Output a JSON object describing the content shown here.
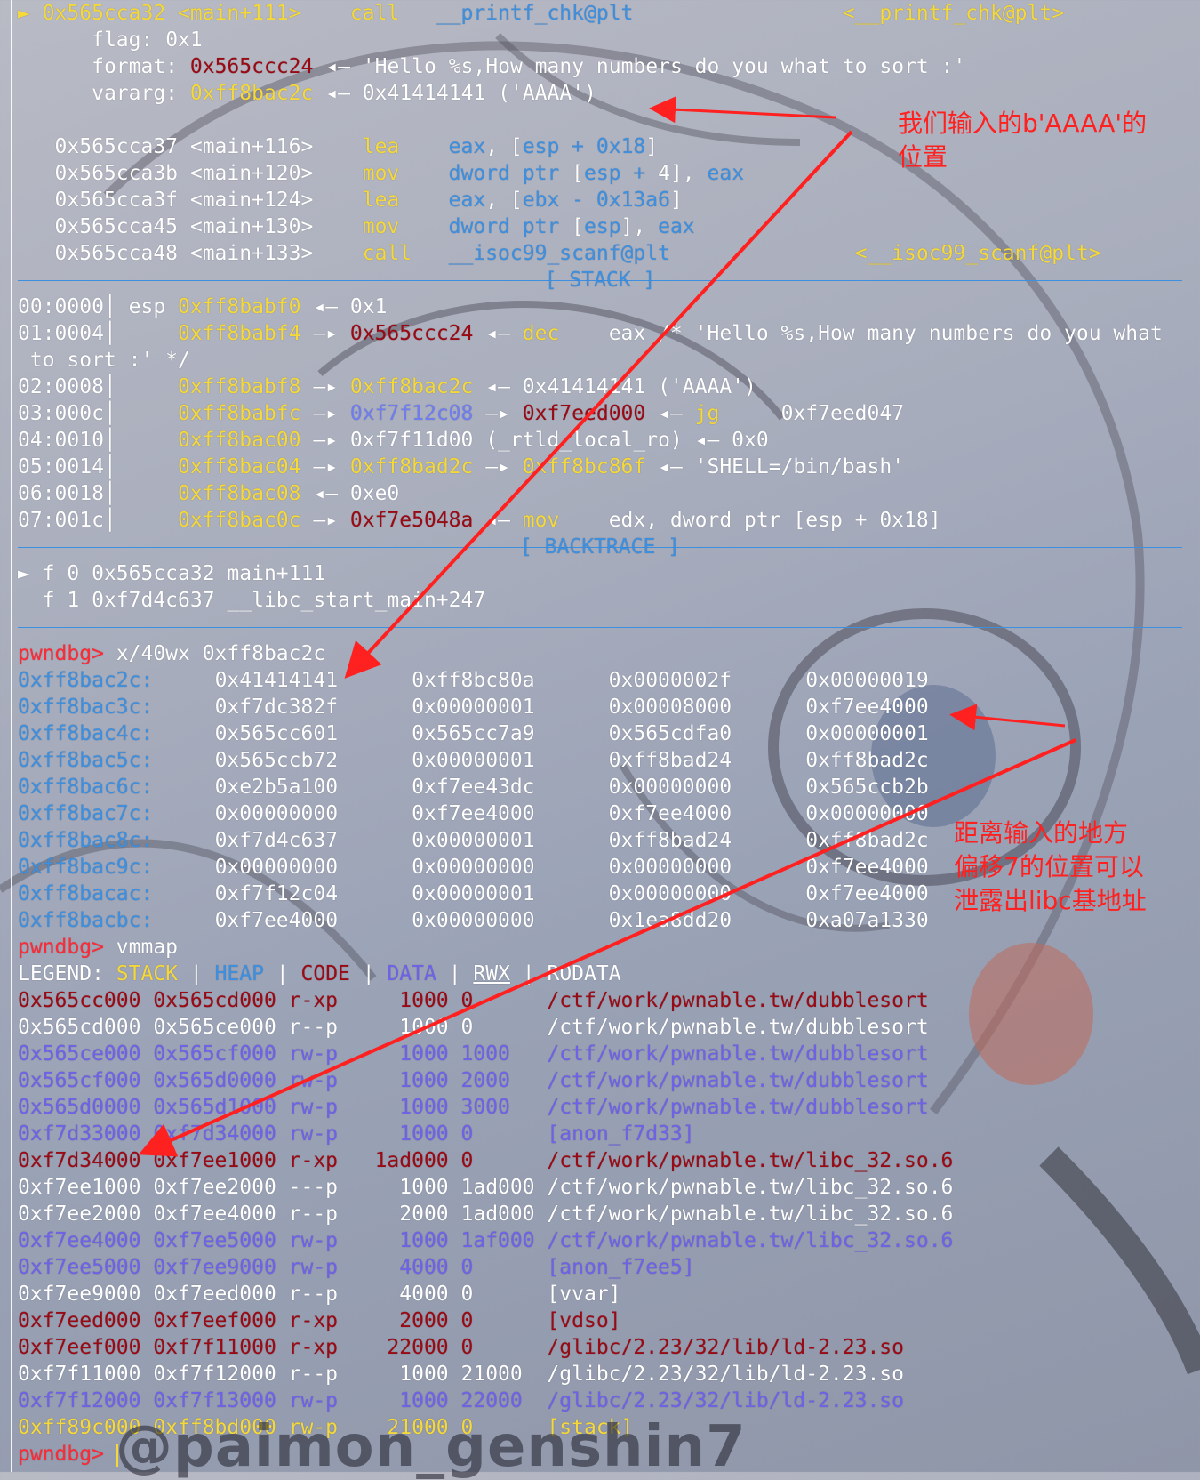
{
  "terminal": {
    "disasm": [
      {
        "marker": "►",
        "addr": "0x565cca32",
        "sym": "<main+111>",
        "mn": "call",
        "op": "__printf_chk@plt",
        "target": "<__printf_chk@plt>"
      },
      {
        "indent": "      ",
        "label": "flag:",
        "val": "0x1"
      },
      {
        "indent": "      ",
        "label": "format:",
        "val": "0x565ccc24",
        "arrow": "◂—",
        "rest": "'Hello %s,How many numbers do you what to sort :'"
      },
      {
        "indent": "      ",
        "label": "vararg:",
        "val": "0xff8bac2c",
        "arrow": "◂—",
        "rest": "0x41414141 ('AAAA')"
      },
      {
        "addr": "0x565cca37",
        "sym": "<main+116>",
        "mn": "lea",
        "op": "eax, [esp + 0x18]"
      },
      {
        "addr": "0x565cca3b",
        "sym": "<main+120>",
        "mn": "mov",
        "op": "dword ptr [esp + 4], eax"
      },
      {
        "addr": "0x565cca3f",
        "sym": "<main+124>",
        "mn": "lea",
        "op": "eax, [ebx - 0x13a6]"
      },
      {
        "addr": "0x565cca45",
        "sym": "<main+130>",
        "mn": "mov",
        "op": "dword ptr [esp], eax"
      },
      {
        "addr": "0x565cca48",
        "sym": "<main+133>",
        "mn": "call",
        "op": "__isoc99_scanf@plt",
        "target": "<__isoc99_scanf@plt>"
      }
    ],
    "stack_header": "[ STACK ]",
    "stack": [
      "00:0000│ esp 0xff8babf0 ◂— 0x1",
      "01:0004│     0xff8babf4 —▸ 0x565ccc24 ◂— dec    eax /* 'Hello %s,How many numbers do you what",
      " to sort :' */",
      "02:0008│     0xff8babf8 —▸ 0xff8bac2c ◂— 0x41414141 ('AAAA')",
      "03:000c│     0xff8babfc —▸ 0xf7f12c08 —▸ 0xf7eed000 ◂— jg     0xf7eed047",
      "04:0010│     0xff8bac00 —▸ 0xf7f11d00 (_rtld_local_ro) ◂— 0x0",
      "05:0014│     0xff8bac04 —▸ 0xff8bad2c —▸ 0xff8bc86f ◂— 'SHELL=/bin/bash'",
      "06:0018│     0xff8bac08 ◂— 0xe0",
      "07:001c│     0xff8bac0c —▸ 0xf7e5048a ◂— mov    edx, dword ptr [esp + 0x18]"
    ],
    "backtrace_header": "[ BACKTRACE ]",
    "backtrace": [
      "► f 0 0x565cca32 main+111",
      "  f 1 0xf7d4c637 __libc_start_main+247"
    ],
    "prompt": "pwndbg>",
    "cmd1": " x/40wx 0xff8bac2c",
    "mem": [
      {
        "a": "0xff8bac2c:",
        "v": [
          "0x41414141",
          "0xff8bc80a",
          "0x0000002f",
          "0x00000019"
        ]
      },
      {
        "a": "0xff8bac3c:",
        "v": [
          "0xf7dc382f",
          "0x00000001",
          "0x00008000",
          "0xf7ee4000"
        ]
      },
      {
        "a": "0xff8bac4c:",
        "v": [
          "0x565cc601",
          "0x565cc7a9",
          "0x565cdfa0",
          "0x00000001"
        ]
      },
      {
        "a": "0xff8bac5c:",
        "v": [
          "0x565ccb72",
          "0x00000001",
          "0xff8bad24",
          "0xff8bad2c"
        ]
      },
      {
        "a": "0xff8bac6c:",
        "v": [
          "0xe2b5a100",
          "0xf7ee43dc",
          "0x00000000",
          "0x565ccb2b"
        ]
      },
      {
        "a": "0xff8bac7c:",
        "v": [
          "0x00000000",
          "0xf7ee4000",
          "0xf7ee4000",
          "0x00000000"
        ]
      },
      {
        "a": "0xff8bac8c:",
        "v": [
          "0xf7d4c637",
          "0x00000001",
          "0xff8bad24",
          "0xff8bad2c"
        ]
      },
      {
        "a": "0xff8bac9c:",
        "v": [
          "0x00000000",
          "0x00000000",
          "0x00000000",
          "0xf7ee4000"
        ]
      },
      {
        "a": "0xff8bacac:",
        "v": [
          "0xf7f12c04",
          "0x00000001",
          "0x00000000",
          "0xf7ee4000"
        ]
      },
      {
        "a": "0xff8bacbc:",
        "v": [
          "0xf7ee4000",
          "0x00000000",
          "0x1ea8dd20",
          "0xa07a1330"
        ]
      }
    ],
    "cmd2": " vmmap",
    "legend": {
      "label": "LEGEND:",
      "stack": "STACK",
      "heap": "HEAP",
      "code": "CODE",
      "data": "DATA",
      "rwx": "RWX",
      "rodata": "RODATA"
    },
    "vmmap": [
      {
        "c": "r",
        "t": "0x565cc000 0x565cd000 r-xp     1000 0      /ctf/work/pwnable.tw/dubblesort"
      },
      {
        "c": "wt",
        "t": "0x565cd000 0x565ce000 r--p     1000 0      /ctf/work/pwnable.tw/dubblesort"
      },
      {
        "c": "pu",
        "t": "0x565ce000 0x565cf000 rw-p     1000 1000   /ctf/work/pwnable.tw/dubblesort"
      },
      {
        "c": "pu",
        "t": "0x565cf000 0x565d0000 rw-p     1000 2000   /ctf/work/pwnable.tw/dubblesort"
      },
      {
        "c": "pu",
        "t": "0x565d0000 0x565d1000 rw-p     1000 3000   /ctf/work/pwnable.tw/dubblesort"
      },
      {
        "c": "pu",
        "t": "0xf7d33000 0xf7d34000 rw-p     1000 0      [anon_f7d33]"
      },
      {
        "c": "r",
        "t": "0xf7d34000 0xf7ee1000 r-xp   1ad000 0      /ctf/work/pwnable.tw/libc_32.so.6"
      },
      {
        "c": "wt",
        "t": "0xf7ee1000 0xf7ee2000 ---p     1000 1ad000 /ctf/work/pwnable.tw/libc_32.so.6"
      },
      {
        "c": "wt",
        "t": "0xf7ee2000 0xf7ee4000 r--p     2000 1ad000 /ctf/work/pwnable.tw/libc_32.so.6"
      },
      {
        "c": "pu",
        "t": "0xf7ee4000 0xf7ee5000 rw-p     1000 1af000 /ctf/work/pwnable.tw/libc_32.so.6"
      },
      {
        "c": "pu",
        "t": "0xf7ee5000 0xf7ee9000 rw-p     4000 0      [anon_f7ee5]"
      },
      {
        "c": "wt",
        "t": "0xf7ee9000 0xf7eed000 r--p     4000 0      [vvar]"
      },
      {
        "c": "r",
        "t": "0xf7eed000 0xf7eef000 r-xp     2000 0      [vdso]"
      },
      {
        "c": "r",
        "t": "0xf7eef000 0xf7f11000 r-xp    22000 0      /glibc/2.23/32/lib/ld-2.23.so"
      },
      {
        "c": "wt",
        "t": "0xf7f11000 0xf7f12000 r--p     1000 21000  /glibc/2.23/32/lib/ld-2.23.so"
      },
      {
        "c": "pu",
        "t": "0xf7f12000 0xf7f13000 rw-p     1000 22000  /glibc/2.23/32/lib/ld-2.23.so"
      },
      {
        "c": "y",
        "t": "0xff89c000 0xff8bd000 rw-p    21000 0      [stack]"
      }
    ]
  },
  "annotations": {
    "note1": "我们输入的b'AAAA'的\n位置",
    "note2": "距离输入的地方\n偏移7的位置可以\n泄露出libc基地址"
  },
  "watermark": "@paimon_genshin7",
  "colors": {
    "annotation": "#ff2020",
    "yellow": "#f5d93a",
    "dark_red": "#9a0a14",
    "blue": "#3d8fe0",
    "purple": "#6f62e8"
  }
}
